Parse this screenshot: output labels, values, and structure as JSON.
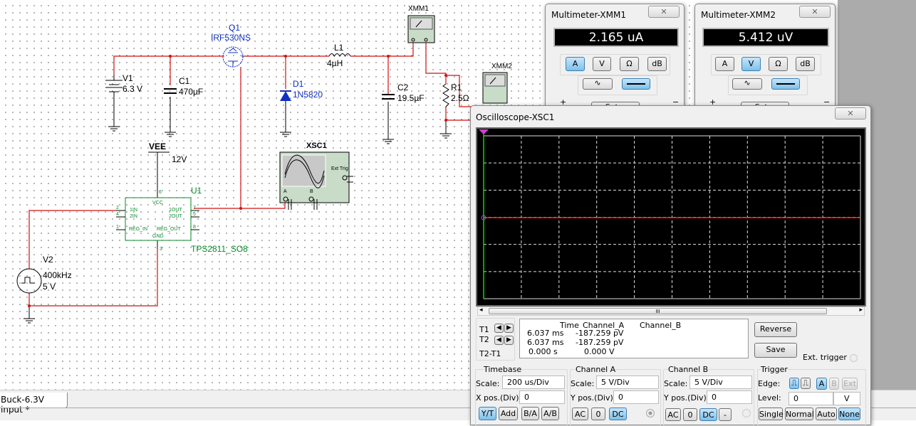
{
  "tab": {
    "label": "Buck-6.3V input *"
  },
  "schematic": {
    "v1": {
      "ref": "V1",
      "value": "6.3 V"
    },
    "c1": {
      "ref": "C1",
      "value": "470µF"
    },
    "q1": {
      "ref": "Q1",
      "value": "IRF530NS"
    },
    "d1": {
      "ref": "D1",
      "value": "1N5820"
    },
    "l1": {
      "ref": "L1",
      "value": "4µH"
    },
    "c2": {
      "ref": "C2",
      "value": "19.5µF"
    },
    "r1": {
      "ref": "R1",
      "value": "2.5Ω"
    },
    "xmm1": {
      "ref": "XMM1"
    },
    "xmm2": {
      "ref": "XMM2"
    },
    "vee": {
      "ref": "VEE",
      "value": "12V"
    },
    "u1": {
      "ref": "U1",
      "part": "TPS2811_SO8",
      "vcc": "VCC",
      "in1": "1IN",
      "in2": "2IN",
      "out1": "1OUT",
      "out2": "2OUT",
      "reg_in": "REG_IN",
      "reg_out": "REG_OUT",
      "gnd": "GND",
      "pins": [
        "6",
        "2",
        "4",
        "1",
        "7",
        "5",
        "8",
        "3"
      ]
    },
    "v2": {
      "ref": "V2",
      "freq": "400kHz",
      "amp": "5 V"
    },
    "xsc1": {
      "ref": "XSC1",
      "ext_trig": "Ext Trig",
      "a": "A",
      "b": "B"
    }
  },
  "multimeters": [
    {
      "title": "Multimeter-XMM1",
      "reading": "2.165 uA",
      "close": "✕",
      "modes": [
        "A",
        "V",
        "Ω",
        "dB"
      ],
      "active_mode": "A",
      "coupling": "DC",
      "plus": "+",
      "minus": "−",
      "set": "Set..."
    },
    {
      "title": "Multimeter-XMM2",
      "reading": "5.412 uV",
      "close": "✕",
      "modes": [
        "A",
        "V",
        "Ω",
        "dB"
      ],
      "active_mode": "V",
      "coupling": "DC",
      "plus": "+",
      "minus": "−",
      "set": "Set..."
    }
  ],
  "scope": {
    "title": "Oscilloscope-XSC1",
    "close": "✕",
    "colors": {
      "screen": "#000000",
      "trace_a": "#ff2020",
      "cursor": "#00ff00"
    },
    "divisions": {
      "x": 10,
      "y": 6
    },
    "scroll_thumb": "III",
    "cursors": {
      "t1": "T1",
      "t2": "T2",
      "diff": "T2-T1"
    },
    "readout": {
      "headers": [
        "Time",
        "Channel_A",
        "Channel_B"
      ],
      "rows": [
        [
          "6.037 ms",
          "-187.259 pV",
          ""
        ],
        [
          "6.037 ms",
          "-187.259 pV",
          ""
        ],
        [
          "0.000 s",
          "0.000 V",
          ""
        ]
      ]
    },
    "reverse": "Reverse",
    "save": "Save",
    "ext_trigger": "Ext. trigger",
    "timebase": {
      "title": "Timebase",
      "scale_label": "Scale:",
      "scale": "200 us/Div",
      "xpos_label": "X pos.(Div):",
      "xpos": "0",
      "modes": [
        "Y/T",
        "Add",
        "B/A",
        "A/B"
      ],
      "active": "Y/T"
    },
    "channel_a": {
      "title": "Channel A",
      "scale_label": "Scale:",
      "scale": "5  V/Div",
      "ypos_label": "Y pos.(Div):",
      "ypos": "0",
      "coupling": [
        "AC",
        "0",
        "DC"
      ],
      "active": "DC"
    },
    "channel_b": {
      "title": "Channel B",
      "scale_label": "Scale:",
      "scale": "5  V/Div",
      "ypos_label": "Y pos.(Div):",
      "ypos": "0",
      "coupling": [
        "AC",
        "0",
        "DC",
        "-"
      ],
      "active": "DC"
    },
    "trigger": {
      "title": "Trigger",
      "edge_label": "Edge:",
      "edges": [
        "rising-edge",
        "falling-edge"
      ],
      "sources": [
        "A",
        "B",
        "Ext"
      ],
      "active_source": "A",
      "level_label": "Level:",
      "level": "0",
      "level_unit": "V",
      "modes": [
        "Single",
        "Normal",
        "Auto",
        "None"
      ],
      "active_mode": "None"
    }
  }
}
